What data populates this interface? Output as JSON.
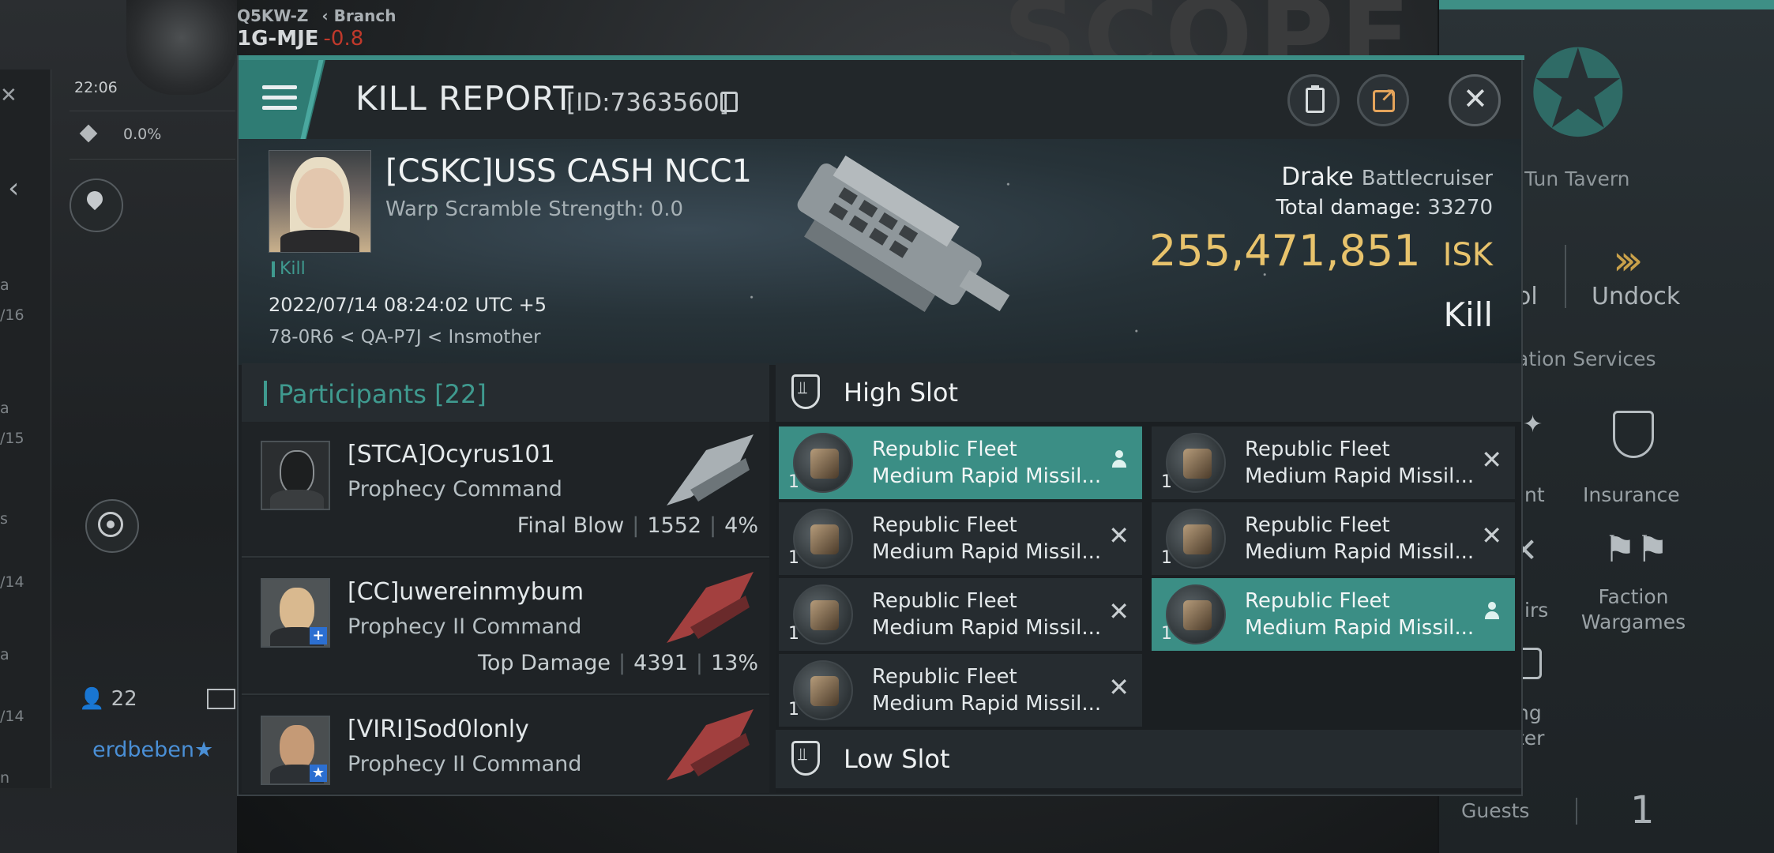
{
  "background": {
    "system_region": "Q5KW-Z",
    "branch_label": "Branch",
    "system_name": "1G-MJE",
    "system_security": "-0.8",
    "clock": "22:06",
    "cargo_pct": "0.0%",
    "people_count": "22",
    "username": "erdbeben",
    "station_name": "JE - Tun Tavern",
    "undock_label": "Undock",
    "ol_fragment": "ol",
    "services_fragment": "ation Services",
    "insurance_label": "Insurance",
    "faction_wargames_label": "Faction Wargames",
    "nt_fragment": "nt",
    "irs_fragment": "irs",
    "ng_fragment": "ng",
    "ter_fragment": "ter",
    "guests_label": "Guests",
    "guests_count": "1",
    "left_fragments": [
      "a",
      "/16",
      "a",
      "/15",
      "s",
      "/14",
      "a",
      "/14",
      "n"
    ]
  },
  "header": {
    "title": "KILL REPORT",
    "id_text": "[ID:7363560]",
    "accent_color": "#3f9a8f"
  },
  "victim": {
    "name": "[CSKC]USS CASH NCC1",
    "warp_scramble": "Warp Scramble Strength: 0.0",
    "kill_tag": "Kill",
    "datetime": "2022/07/14 08:24:02 UTC +5",
    "location": "78-0R6 < QA-P7J < Insmother",
    "ship_name": "Drake",
    "ship_class": "Battlecruiser",
    "total_damage_label": "Total damage:",
    "total_damage": "33270",
    "isk_value": "255,471,851",
    "isk_unit": "ISK",
    "result": "Kill"
  },
  "participants": {
    "label": "Participants",
    "count": "[22]",
    "rows": [
      {
        "name": "[STCA]Ocyrus101",
        "ship": "Prophecy Command",
        "stat_label": "Final Blow",
        "damage": "1552",
        "pct": "4%"
      },
      {
        "name": "[CC]uwereinmybum",
        "ship": "Prophecy II Command",
        "stat_label": "Top Damage",
        "damage": "4391",
        "pct": "13%"
      },
      {
        "name": "[VIRI]Sod0lonly",
        "ship": "Prophecy II Command"
      }
    ]
  },
  "slots": {
    "high_label": "High Slot",
    "low_label": "Low Slot",
    "modules": [
      {
        "line1": "Republic Fleet",
        "line2": "Medium Rapid Missil...",
        "qty": "1",
        "state": "dropped"
      },
      {
        "line1": "Republic Fleet",
        "line2": "Medium Rapid Missil...",
        "qty": "1",
        "state": "destroyed"
      },
      {
        "line1": "Republic Fleet",
        "line2": "Medium Rapid Missil...",
        "qty": "1",
        "state": "destroyed"
      },
      {
        "line1": "Republic Fleet",
        "line2": "Medium Rapid Missil...",
        "qty": "1",
        "state": "destroyed"
      },
      {
        "line1": "Republic Fleet",
        "line2": "Medium Rapid Missil...",
        "qty": "1",
        "state": "destroyed"
      },
      {
        "line1": "Republic Fleet",
        "line2": "Medium Rapid Missil...",
        "qty": "1",
        "state": "dropped"
      },
      {
        "line1": "Republic Fleet",
        "line2": "Medium Rapid Missil...",
        "qty": "1",
        "state": "destroyed"
      }
    ]
  }
}
